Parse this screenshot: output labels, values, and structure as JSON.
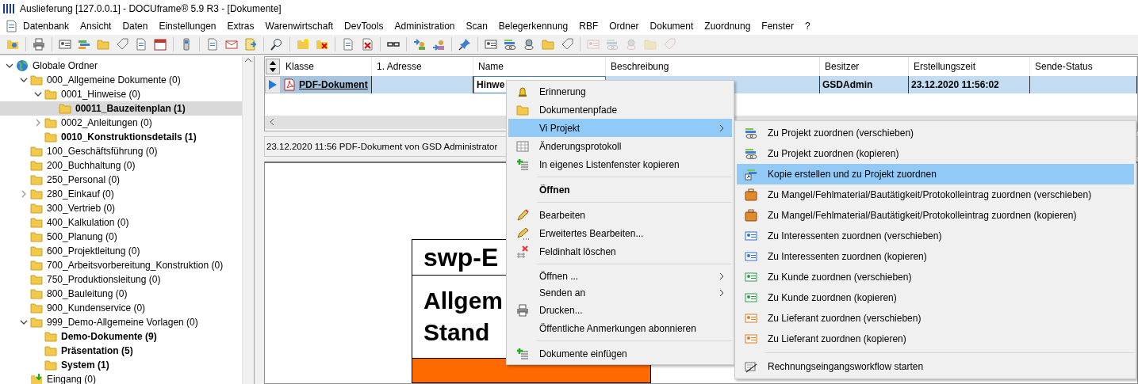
{
  "window": {
    "title": "Auslieferung [127.0.0.1] - DOCUframe® 5.9 R3 - [Dokumente]"
  },
  "menu_bar": [
    "Datenbank",
    "Ansicht",
    "Daten",
    "Einstellungen",
    "Extras",
    "Warenwirtschaft",
    "DevTools",
    "Administration",
    "Scan",
    "Belegerkennung",
    "RBF",
    "Ordner",
    "Dokument",
    "Zuordnung",
    "Fenster",
    "?"
  ],
  "toolbar": [
    [
      {
        "disabled": false
      }
    ],
    [
      {
        "disabled": false
      }
    ],
    [
      {
        "disabled": false
      },
      {
        "disabled": false
      },
      {
        "disabled": false
      },
      {
        "disabled": false
      },
      {
        "disabled": false
      },
      {
        "disabled": false
      }
    ],
    [
      {
        "disabled": false
      }
    ],
    [
      {
        "disabled": false
      },
      {
        "disabled": false
      },
      {
        "disabled": false
      }
    ],
    [
      {
        "disabled": false
      }
    ],
    [
      {
        "disabled": false
      },
      {
        "disabled": false
      }
    ],
    [
      {
        "disabled": false
      },
      {
        "disabled": false
      }
    ],
    [
      {
        "disabled": false
      }
    ],
    [
      {
        "disabled": false
      },
      {
        "disabled": false
      }
    ],
    [
      {
        "disabled": false
      }
    ],
    [
      {
        "disabled": false
      },
      {
        "disabled": false
      },
      {
        "disabled": false
      },
      {
        "disabled": false
      },
      {
        "disabled": false
      }
    ],
    [
      {
        "disabled": true
      },
      {
        "disabled": true
      },
      {
        "disabled": true
      },
      {
        "disabled": true
      },
      {
        "disabled": true
      }
    ]
  ],
  "tree": {
    "label": "Globale Ordner",
    "kind": "globe",
    "expanded": true,
    "bold": false,
    "selected": false,
    "children": [
      {
        "label": "000_Allgemeine Dokumente (0)",
        "kind": "folder",
        "expanded": true,
        "bold": false,
        "selected": false,
        "children": [
          {
            "label": "0001_Hinweise (0)",
            "kind": "folder",
            "expanded": true,
            "bold": false,
            "selected": false,
            "children": [
              {
                "label": "00011_Bauzeitenplan (1)",
                "kind": "folder",
                "bold": true,
                "selected": true
              }
            ]
          },
          {
            "label": "0002_Anleitungen (0)",
            "kind": "folder",
            "expanded": false,
            "bold": false,
            "selected": false
          },
          {
            "label": "0010_Konstruktionsdetails (1)",
            "kind": "folder",
            "bold": true,
            "selected": false
          }
        ]
      },
      {
        "label": "100_Geschäftsführung (0)",
        "kind": "folder",
        "bold": false,
        "selected": false
      },
      {
        "label": "200_Buchhaltung (0)",
        "kind": "folder",
        "bold": false,
        "selected": false
      },
      {
        "label": "250_Personal (0)",
        "kind": "folder",
        "bold": false,
        "selected": false
      },
      {
        "label": "280_Einkauf (0)",
        "kind": "folder",
        "expanded": false,
        "bold": false,
        "selected": false
      },
      {
        "label": "300_Vertrieb (0)",
        "kind": "folder",
        "bold": false,
        "selected": false
      },
      {
        "label": "400_Kalkulation (0)",
        "kind": "folder",
        "bold": false,
        "selected": false
      },
      {
        "label": "500_Planung (0)",
        "kind": "folder",
        "bold": false,
        "selected": false
      },
      {
        "label": "600_Projektleitung (0)",
        "kind": "folder",
        "bold": false,
        "selected": false
      },
      {
        "label": "700_Arbeitsvorbereitung_Konstruktion (0)",
        "kind": "folder",
        "bold": false,
        "selected": false
      },
      {
        "label": "750_Produktionsleitung (0)",
        "kind": "folder",
        "bold": false,
        "selected": false
      },
      {
        "label": "800_Bauleitung (0)",
        "kind": "folder",
        "bold": false,
        "selected": false
      },
      {
        "label": "900_Kundenservice (0)",
        "kind": "folder",
        "bold": false,
        "selected": false
      },
      {
        "label": "999_Demo-Allgemeine Vorlagen (0)",
        "kind": "folder",
        "expanded": true,
        "bold": false,
        "selected": false,
        "children": [
          {
            "label": "Demo-Dokumente (9)",
            "kind": "folder",
            "bold": true,
            "selected": false
          },
          {
            "label": "Präsentation (5)",
            "kind": "folder",
            "bold": true,
            "selected": false
          },
          {
            "label": "System (1)",
            "kind": "folder",
            "bold": true,
            "selected": false
          }
        ]
      },
      {
        "label": "Eingang (0)",
        "kind": "inbox",
        "bold": false,
        "selected": false
      }
    ]
  },
  "grid": {
    "columns": [
      "Klasse",
      "1. Adresse",
      "Name",
      "Beschreibung",
      "Besitzer",
      "Erstellungszeit",
      "Sende-Status"
    ],
    "rows": [
      {
        "selected": true,
        "klasse": "PDF-Dokument",
        "name": "Hinwe",
        "besitzer": "GSDAdmin",
        "erstellungszeit": "23.12.2020 11:56:02"
      }
    ]
  },
  "info_line": "23.12.2020 11:56 PDF-Dokument von GSD Administrator",
  "preview": {
    "title": "swp-E",
    "lines": [
      "Allgem",
      "Stand"
    ]
  },
  "context_menu": [
    {
      "kind": "item",
      "label": "Erinnerung",
      "bold": false,
      "selected": false,
      "submenu": false
    },
    {
      "kind": "item",
      "label": "Dokumentenpfade",
      "bold": false,
      "selected": false,
      "submenu": false
    },
    {
      "kind": "item",
      "label": "Vi Projekt",
      "bold": false,
      "selected": true,
      "submenu": true
    },
    {
      "kind": "item",
      "label": "Änderungsprotokoll",
      "bold": false,
      "selected": false,
      "submenu": false
    },
    {
      "kind": "item",
      "label": "In eigenes Listenfenster kopieren",
      "bold": false,
      "selected": false,
      "submenu": false
    },
    {
      "kind": "separator"
    },
    {
      "kind": "item",
      "label": "Öffnen",
      "bold": true,
      "selected": false,
      "submenu": false
    },
    {
      "kind": "separator"
    },
    {
      "kind": "item",
      "label": "Bearbeiten",
      "bold": false,
      "selected": false,
      "submenu": false
    },
    {
      "kind": "item",
      "label": "Erweitertes Bearbeiten...",
      "bold": false,
      "selected": false,
      "submenu": false
    },
    {
      "kind": "item",
      "label": "Feldinhalt löschen",
      "bold": false,
      "selected": false,
      "submenu": false
    },
    {
      "kind": "separator"
    },
    {
      "kind": "item",
      "label": "Öffnen ...",
      "bold": false,
      "selected": false,
      "submenu": true
    },
    {
      "kind": "item",
      "label": "Senden an",
      "bold": false,
      "selected": false,
      "submenu": true
    },
    {
      "kind": "item",
      "label": "Drucken...",
      "bold": false,
      "selected": false,
      "submenu": false
    },
    {
      "kind": "item",
      "label": "Öffentliche Anmerkungen abonnieren",
      "bold": false,
      "selected": false,
      "submenu": false
    },
    {
      "kind": "separator"
    },
    {
      "kind": "item",
      "label": "Dokumente einfügen",
      "bold": false,
      "selected": false,
      "submenu": false
    }
  ],
  "submenu": [
    {
      "kind": "item",
      "label": "Zu Projekt zuordnen (verschieben)",
      "selected": false
    },
    {
      "kind": "item",
      "label": "Zu Projekt zuordnen (kopieren)",
      "selected": false
    },
    {
      "kind": "item",
      "label": "Kopie erstellen und zu Projekt zuordnen",
      "selected": true
    },
    {
      "kind": "item",
      "label": "Zu Mangel/Fehlmaterial/Bautätigkeit/Protokolleintrag zuordnen (verschieben)",
      "selected": false
    },
    {
      "kind": "item",
      "label": "Zu Mangel/Fehlmaterial/Bautätigkeit/Protokolleintrag zuordnen (kopieren)",
      "selected": false
    },
    {
      "kind": "item",
      "label": "Zu Interessenten zuordnen (verschieben)",
      "selected": false
    },
    {
      "kind": "item",
      "label": "Zu Interessenten zuordnen (kopieren)",
      "selected": false
    },
    {
      "kind": "item",
      "label": "Zu Kunde zuordnen (verschieben)",
      "selected": false
    },
    {
      "kind": "item",
      "label": "Zu Kunde zuordnen (kopieren)",
      "selected": false
    },
    {
      "kind": "item",
      "label": "Zu Lieferant zuordnen (verschieben)",
      "selected": false
    },
    {
      "kind": "item",
      "label": "Zu Lieferant zuordnen (kopieren)",
      "selected": false
    },
    {
      "kind": "separator"
    },
    {
      "kind": "item",
      "label": "Rechnungseingangsworkflow starten",
      "selected": false
    }
  ]
}
